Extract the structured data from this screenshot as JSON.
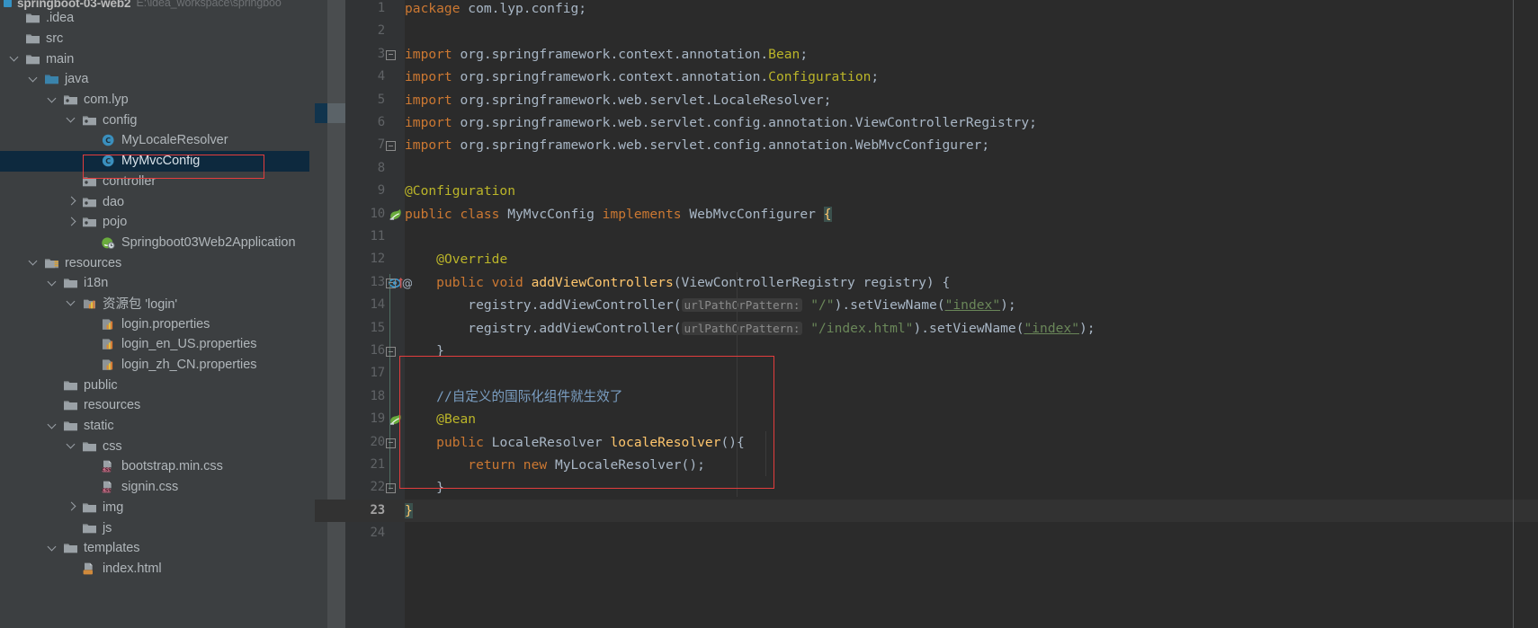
{
  "window": {
    "project_name": "springboot-03-web2",
    "project_path": "E:\\idea_workspace\\springboo"
  },
  "project_tree": {
    "items": [
      {
        "label": ".idea",
        "depth": 0,
        "arrow": "none",
        "icon": "folder-icon",
        "selected": false
      },
      {
        "label": "src",
        "depth": 0,
        "arrow": "none",
        "icon": "folder-icon",
        "selected": false
      },
      {
        "label": "main",
        "depth": 0,
        "arrow": "expanded",
        "icon": "folder-icon",
        "selected": false
      },
      {
        "label": "java",
        "depth": 1,
        "arrow": "expanded",
        "icon": "source-folder-icon",
        "selected": false
      },
      {
        "label": "com.lyp",
        "depth": 2,
        "arrow": "expanded",
        "icon": "package-icon",
        "selected": false
      },
      {
        "label": "config",
        "depth": 3,
        "arrow": "expanded",
        "icon": "package-icon",
        "selected": false
      },
      {
        "label": "MyLocaleResolver",
        "depth": 4,
        "arrow": "none",
        "icon": "java-class-icon",
        "selected": false
      },
      {
        "label": "MyMvcConfig",
        "depth": 4,
        "arrow": "none",
        "icon": "java-class-icon",
        "selected": true
      },
      {
        "label": "controller",
        "depth": 3,
        "arrow": "none",
        "icon": "package-icon",
        "selected": false
      },
      {
        "label": "dao",
        "depth": 3,
        "arrow": "collapsed",
        "icon": "package-icon",
        "selected": false
      },
      {
        "label": "pojo",
        "depth": 3,
        "arrow": "collapsed",
        "icon": "package-icon",
        "selected": false
      },
      {
        "label": "Springboot03Web2Application",
        "depth": 4,
        "arrow": "none",
        "icon": "spring-boot-app-icon",
        "selected": false
      },
      {
        "label": "resources",
        "depth": 1,
        "arrow": "expanded",
        "icon": "resource-folder-icon",
        "selected": false
      },
      {
        "label": "i18n",
        "depth": 2,
        "arrow": "expanded",
        "icon": "folder-icon",
        "selected": false
      },
      {
        "label": "资源包 'login'",
        "depth": 3,
        "arrow": "expanded",
        "icon": "resource-bundle-icon",
        "selected": false
      },
      {
        "label": "login.properties",
        "depth": 4,
        "arrow": "none",
        "icon": "properties-file-icon",
        "selected": false
      },
      {
        "label": "login_en_US.properties",
        "depth": 4,
        "arrow": "none",
        "icon": "properties-file-icon",
        "selected": false
      },
      {
        "label": "login_zh_CN.properties",
        "depth": 4,
        "arrow": "none",
        "icon": "properties-file-icon",
        "selected": false
      },
      {
        "label": "public",
        "depth": 2,
        "arrow": "none",
        "icon": "folder-icon",
        "selected": false
      },
      {
        "label": "resources",
        "depth": 2,
        "arrow": "none",
        "icon": "folder-icon",
        "selected": false
      },
      {
        "label": "static",
        "depth": 2,
        "arrow": "expanded",
        "icon": "folder-icon",
        "selected": false
      },
      {
        "label": "css",
        "depth": 3,
        "arrow": "expanded",
        "icon": "folder-icon",
        "selected": false
      },
      {
        "label": "bootstrap.min.css",
        "depth": 4,
        "arrow": "none",
        "icon": "css-file-icon",
        "selected": false
      },
      {
        "label": "signin.css",
        "depth": 4,
        "arrow": "none",
        "icon": "css-file-icon",
        "selected": false
      },
      {
        "label": "img",
        "depth": 3,
        "arrow": "collapsed",
        "icon": "folder-icon",
        "selected": false
      },
      {
        "label": "js",
        "depth": 3,
        "arrow": "none",
        "icon": "folder-icon",
        "selected": false
      },
      {
        "label": "templates",
        "depth": 2,
        "arrow": "expanded",
        "icon": "folder-icon",
        "selected": false
      },
      {
        "label": "index.html",
        "depth": 3,
        "arrow": "none",
        "icon": "html-file-icon",
        "selected": false
      }
    ]
  },
  "editor": {
    "cursor_line": 23,
    "lines": [
      {
        "n": 1,
        "html": "<span class=\"k\">package</span> com.lyp.config;"
      },
      {
        "n": 2,
        "html": ""
      },
      {
        "n": 3,
        "html": "<span class=\"k\">import</span> org.springframework.context.annotation.<span class=\"ann\">Bean</span>;"
      },
      {
        "n": 4,
        "html": "<span class=\"k\">import</span> org.springframework.context.annotation.<span class=\"ann\">Configuration</span>;"
      },
      {
        "n": 5,
        "html": "<span class=\"k\">import</span> org.springframework.web.servlet.LocaleResolver;"
      },
      {
        "n": 6,
        "html": "<span class=\"k\">import</span> org.springframework.web.servlet.config.annotation.ViewControllerRegistry;"
      },
      {
        "n": 7,
        "html": "<span class=\"k\">import</span> org.springframework.web.servlet.config.annotation.WebMvcConfigurer;"
      },
      {
        "n": 8,
        "html": ""
      },
      {
        "n": 9,
        "html": "<span class=\"ann\">@Configuration</span>"
      },
      {
        "n": 10,
        "html": "<span class=\"k\">public class</span> MyMvcConfig <span class=\"k\">implements</span> WebMvcConfigurer <span class=\"curly-hl\">{</span>"
      },
      {
        "n": 11,
        "html": ""
      },
      {
        "n": 12,
        "html": "    <span class=\"ann\">@Override</span>"
      },
      {
        "n": 13,
        "html": "    <span class=\"k\">public void</span> <span class=\"fn\">addViewControllers</span>(ViewControllerRegistry registry) {"
      },
      {
        "n": 14,
        "html": "        registry.addViewController(<span class=\"hintchip\">urlPathOrPattern:</span> <span class=\"str\">\"/\"</span>).setViewName(<span class=\"str und\">\"index\"</span>);"
      },
      {
        "n": 15,
        "html": "        registry.addViewController(<span class=\"hintchip\">urlPathOrPattern:</span> <span class=\"str\">\"/index.html\"</span>).setViewName(<span class=\"str und\">\"index\"</span>);"
      },
      {
        "n": 16,
        "html": "    }"
      },
      {
        "n": 17,
        "html": ""
      },
      {
        "n": 18,
        "html": "    <span class=\"cmt2\">//自定义的国际化组件就生效了</span>"
      },
      {
        "n": 19,
        "html": "    <span class=\"ann\">@Bean</span>"
      },
      {
        "n": 20,
        "html": "    <span class=\"k\">public</span> LocaleResolver <span class=\"fn\">localeResolver</span>(){"
      },
      {
        "n": 21,
        "html": "        <span class=\"k\">return new</span> MyLocaleResolver();"
      },
      {
        "n": 22,
        "html": "    }"
      },
      {
        "n": 23,
        "html": "<span class=\"curly-hl\">}</span>"
      },
      {
        "n": 24,
        "html": ""
      }
    ],
    "gutter_icons": [
      {
        "line": 10,
        "name": "spring-bean-gutter-icon"
      },
      {
        "line": 13,
        "name": "overriding-method-gutter-icon"
      },
      {
        "line": 19,
        "name": "spring-bean-gutter-icon"
      }
    ],
    "inlay_hints": [
      "urlPathOrPattern:"
    ],
    "annotations": {
      "code_highlight_box_color": "#e33d3d",
      "tree_highlight_box_color": "#e33d3d"
    }
  },
  "colors": {
    "editor_bg": "#2b2b2b",
    "panel_bg": "#3c3f41",
    "gutter_bg": "#313335",
    "selection_bg": "#0d293e",
    "accent_red": "#e33d3d",
    "keyword": "#cc7832",
    "annotation": "#bbb529",
    "string": "#6a8759",
    "method": "#ffc66d",
    "text": "#a9b7c6"
  }
}
